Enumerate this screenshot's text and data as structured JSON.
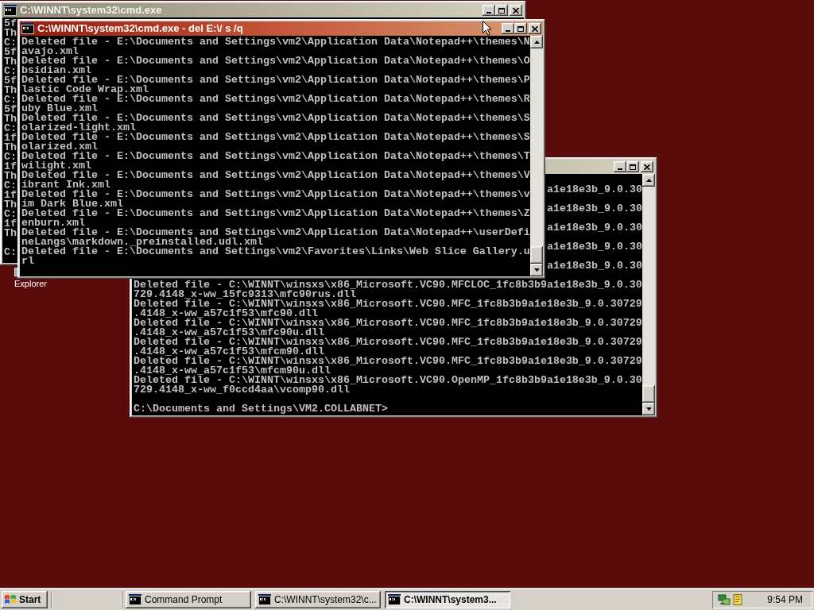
{
  "desktop": {
    "icons": [
      {
        "label": "Explorer"
      }
    ]
  },
  "windows": [
    {
      "title": "C:\\WINNT\\system32\\cmd.exe",
      "active": false,
      "lines": [
        {
          "kind": "line",
          "text": "5f"
        },
        {
          "kind": "line",
          "text": "Th"
        },
        {
          "kind": "line",
          "text": "C:"
        },
        {
          "kind": "line",
          "text": "5f"
        },
        {
          "kind": "line",
          "text": "Th"
        },
        {
          "kind": "line",
          "text": "C:"
        },
        {
          "kind": "line",
          "text": "5f"
        },
        {
          "kind": "line",
          "text": "Th"
        },
        {
          "kind": "line",
          "text": "C:"
        },
        {
          "kind": "line",
          "text": "5f"
        },
        {
          "kind": "line",
          "text": "Th"
        },
        {
          "kind": "line",
          "text": "C:"
        },
        {
          "kind": "line",
          "text": "1f"
        },
        {
          "kind": "line",
          "text": "Th"
        },
        {
          "kind": "line",
          "text": "C:"
        },
        {
          "kind": "line",
          "text": "1f"
        },
        {
          "kind": "line",
          "text": "Th"
        },
        {
          "kind": "line",
          "text": "C:"
        },
        {
          "kind": "line",
          "text": "1f"
        },
        {
          "kind": "line",
          "text": "Th"
        },
        {
          "kind": "line",
          "text": "C:"
        },
        {
          "kind": "line",
          "text": "1f"
        },
        {
          "kind": "line",
          "text": "Th"
        },
        {
          "kind": "blank"
        },
        {
          "kind": "line",
          "text": "C:"
        }
      ]
    },
    {
      "title": "C:\\WINNT\\system32\\cmd.exe - del E:\\/ s /q",
      "active": true,
      "lines": [
        {
          "kind": "line",
          "text": "Deleted file - E:\\Documents and Settings\\vm2\\Application Data\\Notepad++\\themes\\N"
        },
        {
          "kind": "line",
          "text": "avajo.xml"
        },
        {
          "kind": "line",
          "text": "Deleted file - E:\\Documents and Settings\\vm2\\Application Data\\Notepad++\\themes\\O"
        },
        {
          "kind": "line",
          "text": "bsidian.xml"
        },
        {
          "kind": "line",
          "text": "Deleted file - E:\\Documents and Settings\\vm2\\Application Data\\Notepad++\\themes\\P"
        },
        {
          "kind": "line",
          "text": "lastic Code Wrap.xml"
        },
        {
          "kind": "line",
          "text": "Deleted file - E:\\Documents and Settings\\vm2\\Application Data\\Notepad++\\themes\\R"
        },
        {
          "kind": "line",
          "text": "uby Blue.xml"
        },
        {
          "kind": "line",
          "text": "Deleted file - E:\\Documents and Settings\\vm2\\Application Data\\Notepad++\\themes\\S"
        },
        {
          "kind": "line",
          "text": "olarized-light.xml"
        },
        {
          "kind": "line",
          "text": "Deleted file - E:\\Documents and Settings\\vm2\\Application Data\\Notepad++\\themes\\S"
        },
        {
          "kind": "line",
          "text": "olarized.xml"
        },
        {
          "kind": "line",
          "text": "Deleted file - E:\\Documents and Settings\\vm2\\Application Data\\Notepad++\\themes\\T"
        },
        {
          "kind": "line",
          "text": "wilight.xml"
        },
        {
          "kind": "line",
          "text": "Deleted file - E:\\Documents and Settings\\vm2\\Application Data\\Notepad++\\themes\\V"
        },
        {
          "kind": "line",
          "text": "ibrant Ink.xml"
        },
        {
          "kind": "line",
          "text": "Deleted file - E:\\Documents and Settings\\vm2\\Application Data\\Notepad++\\themes\\v"
        },
        {
          "kind": "line",
          "text": "im Dark Blue.xml"
        },
        {
          "kind": "line",
          "text": "Deleted file - E:\\Documents and Settings\\vm2\\Application Data\\Notepad++\\themes\\Z"
        },
        {
          "kind": "line",
          "text": "enburn.xml"
        },
        {
          "kind": "line",
          "text": "Deleted file - E:\\Documents and Settings\\vm2\\Application Data\\Notepad++\\userDefi"
        },
        {
          "kind": "line",
          "text": "neLangs\\markdown._preinstalled.udl.xml"
        },
        {
          "kind": "line",
          "text": "Deleted file - E:\\Documents and Settings\\vm2\\Favorites\\Links\\Web Slice Gallery.u"
        },
        {
          "kind": "line",
          "text": "rl"
        }
      ]
    },
    {
      "active": false,
      "lines": [
        {
          "kind": "blank"
        },
        {
          "kind": "tail",
          "text": "a1e18e3b_9.0.30"
        },
        {
          "kind": "blank"
        },
        {
          "kind": "tail",
          "text": "a1e18e3b_9.0.30"
        },
        {
          "kind": "blank"
        },
        {
          "kind": "tail",
          "text": "a1e18e3b_9.0.30"
        },
        {
          "kind": "blank"
        },
        {
          "kind": "tail",
          "text": "a1e18e3b_9.0.30"
        },
        {
          "kind": "blank"
        },
        {
          "kind": "tail",
          "text": "a1e18e3b_9.0.30"
        },
        {
          "kind": "blank"
        },
        {
          "kind": "line",
          "text": "Deleted file - C:\\WINNT\\winsxs\\x86_Microsoft.VC90.MFCLOC_1fc8b3b9a1e18e3b_9.0.30"
        },
        {
          "kind": "line",
          "text": "729.4148_x-ww_15fc9313\\mfc90rus.dll"
        },
        {
          "kind": "line",
          "text": "Deleted file - C:\\WINNT\\winsxs\\x86_Microsoft.VC90.MFC_1fc8b3b9a1e18e3b_9.0.30729"
        },
        {
          "kind": "line",
          "text": ".4148_x-ww_a57c1f53\\mfc90.dll"
        },
        {
          "kind": "line",
          "text": "Deleted file - C:\\WINNT\\winsxs\\x86_Microsoft.VC90.MFC_1fc8b3b9a1e18e3b_9.0.30729"
        },
        {
          "kind": "line",
          "text": ".4148_x-ww_a57c1f53\\mfc90u.dll"
        },
        {
          "kind": "line",
          "text": "Deleted file - C:\\WINNT\\winsxs\\x86_Microsoft.VC90.MFC_1fc8b3b9a1e18e3b_9.0.30729"
        },
        {
          "kind": "line",
          "text": ".4148_x-ww_a57c1f53\\mfcm90.dll"
        },
        {
          "kind": "line",
          "text": "Deleted file - C:\\WINNT\\winsxs\\x86_Microsoft.VC90.MFC_1fc8b3b9a1e18e3b_9.0.30729"
        },
        {
          "kind": "line",
          "text": ".4148_x-ww_a57c1f53\\mfcm90u.dll"
        },
        {
          "kind": "line",
          "text": "Deleted file - C:\\WINNT\\winsxs\\x86_Microsoft.VC90.OpenMP_1fc8b3b9a1e18e3b_9.0.30"
        },
        {
          "kind": "line",
          "text": "729.4148_x-ww_f0ccd4aa\\vcomp90.dll"
        },
        {
          "kind": "blank"
        },
        {
          "kind": "line",
          "text": "C:\\Documents and Settings\\VM2.COLLABNET>"
        }
      ]
    }
  ],
  "taskbar": {
    "start": "Start",
    "tasks": [
      {
        "label": "Command Prompt",
        "selected": false
      },
      {
        "label": "C:\\WINNT\\system32\\c...",
        "selected": false
      },
      {
        "label": "C:\\WINNT\\system3...",
        "selected": true
      }
    ],
    "clock": "9:54 PM"
  }
}
